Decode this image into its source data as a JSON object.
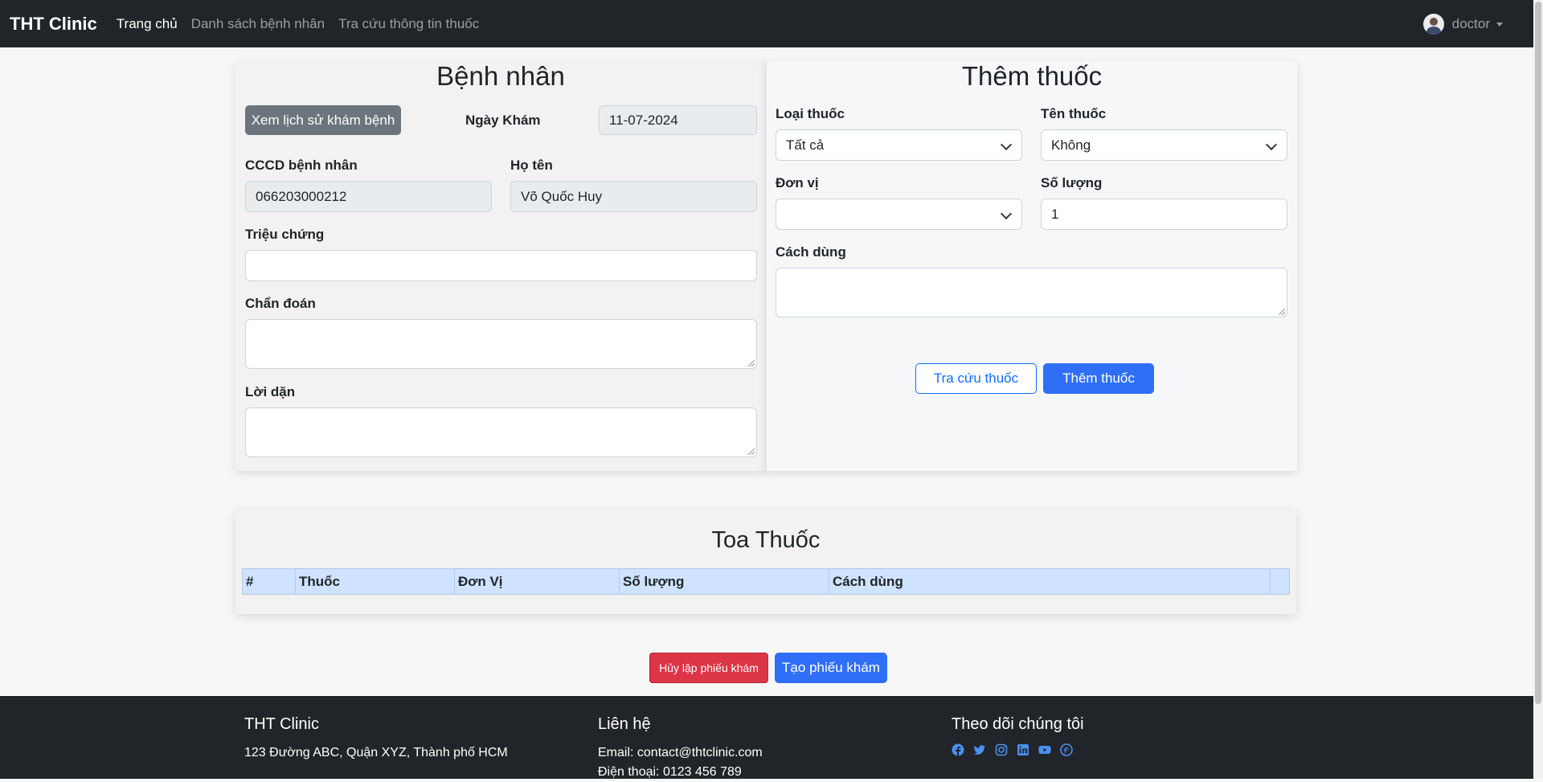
{
  "navbar": {
    "brand": "THT Clinic",
    "links": [
      "Trang chủ",
      "Danh sách bệnh nhân",
      "Tra cứu thông tin thuốc"
    ],
    "user": "doctor"
  },
  "patient": {
    "title": "Bệnh nhân",
    "history_button": "Xem lịch sử khám bệnh",
    "date_label": "Ngày Khám",
    "date_value": "11-07-2024",
    "cccd_label": "CCCD bệnh nhân",
    "cccd_value": "066203000212",
    "name_label": "Họ tên",
    "name_value": "Võ Quốc Huy",
    "symptoms_label": "Triệu chứng",
    "diagnosis_label": "Chẩn đoán",
    "advice_label": "Lời dặn"
  },
  "add_medicine": {
    "title": "Thêm thuốc",
    "type_label": "Loại thuốc",
    "type_value": "Tất cả",
    "name_label": "Tên thuốc",
    "name_value": "Không",
    "unit_label": "Đơn vị",
    "unit_value": "",
    "qty_label": "Số lượng",
    "qty_value": "1",
    "usage_label": "Cách dùng",
    "lookup_button": "Tra cứu thuốc",
    "add_button": "Thêm thuốc"
  },
  "prescription": {
    "title": "Toa Thuốc",
    "columns": [
      "#",
      "Thuốc",
      "Đơn Vị",
      "Số lượng",
      "Cách dùng",
      ""
    ]
  },
  "actions": {
    "cancel": "Hủy lập phiếu khám",
    "create": "Tạo phiếu khám"
  },
  "footer": {
    "col1_title": "THT Clinic",
    "address": "123 Đường ABC, Quận XYZ, Thành phố HCM",
    "col2_title": "Liên hệ",
    "email": "Email: contact@thtclinic.com",
    "phone": "Điện thoại: 0123 456 789",
    "col3_title": "Theo dõi chúng tôi",
    "social_icons": [
      "facebook-icon",
      "twitter-icon",
      "instagram-icon",
      "linkedin-icon",
      "youtube-icon",
      "pinterest-icon"
    ],
    "social_color": "#4a90f0"
  }
}
